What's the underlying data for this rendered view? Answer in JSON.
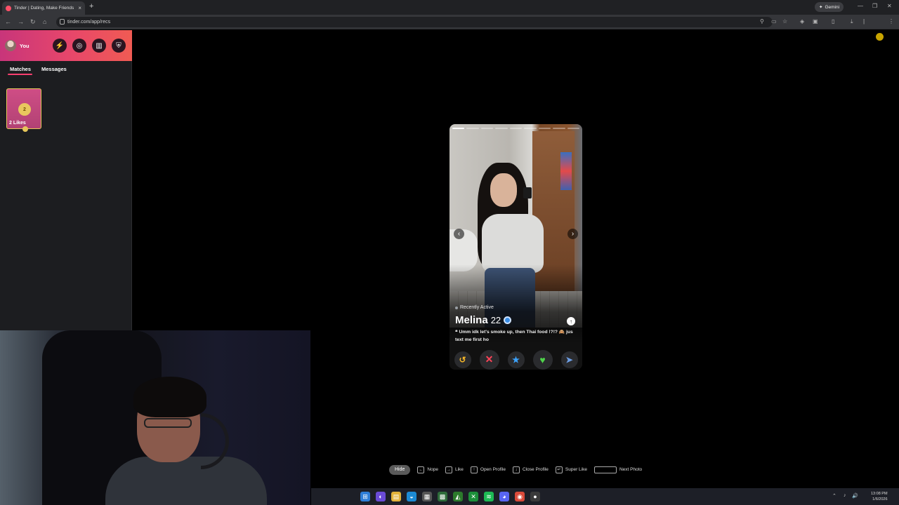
{
  "browser": {
    "tab_title": "Tinder | Dating, Make Friends &",
    "tab_close": "×",
    "new_tab": "+",
    "url": "tinder.com/app/recs",
    "gemini_label": "Gemini"
  },
  "sidebar": {
    "user_label": "You",
    "tabs": [
      {
        "label": "Matches"
      },
      {
        "label": "Messages"
      }
    ],
    "likes": {
      "count": "2",
      "label": "2 Likes"
    }
  },
  "card": {
    "status": "Recently Active",
    "name": "Melina",
    "age": "22",
    "bio": "❝ Umm idk let's smoke up, then Thai food !?!? 🙈 jus text me first ho",
    "photo_count": 9,
    "active_photo": 0,
    "prev_arrow": "‹",
    "next_arrow": "›",
    "info_icon": "↑",
    "actions": {
      "rewind": "↺",
      "nope": "✕",
      "super_like": "★",
      "like": "♥",
      "boost": "➤"
    }
  },
  "hints": {
    "hide": "Hide",
    "items": [
      {
        "key": "←",
        "label": "Nope"
      },
      {
        "key": "→",
        "label": "Like"
      },
      {
        "key": "↑",
        "label": "Open Profile"
      },
      {
        "key": "↓",
        "label": "Close Profile"
      },
      {
        "key": "↵",
        "label": "Super Like"
      },
      {
        "key": "",
        "label": "Next Photo"
      }
    ]
  },
  "taskbar": {
    "time": "13:08 PM",
    "date": "1/6/2026"
  },
  "colors": {
    "brand_gradient_start": "#c8357a",
    "brand_gradient_end": "#f05b53",
    "tab_underline": "#fd3f6f",
    "rewind": "#f3b529",
    "nope": "#ff4458",
    "super_like": "#3ca4ff",
    "like": "#4fd34b"
  }
}
